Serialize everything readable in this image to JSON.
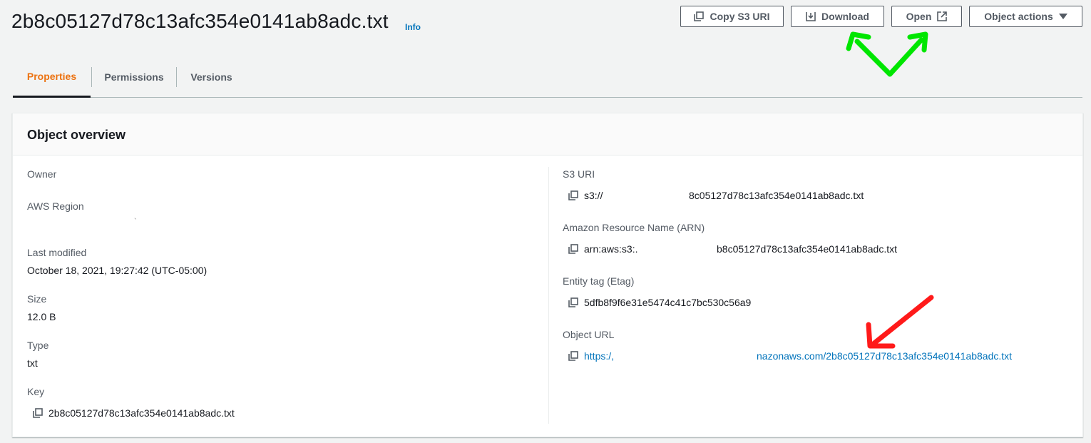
{
  "header": {
    "title": "2b8c05127d78c13afc354e0141ab8adc.txt",
    "info": "Info"
  },
  "toolbar": {
    "copy_label": "Copy S3 URI",
    "download_label": "Download",
    "open_label": "Open",
    "actions_label": "Object actions"
  },
  "tabs": [
    {
      "label": "Properties",
      "active": true
    },
    {
      "label": "Permissions",
      "active": false
    },
    {
      "label": "Versions",
      "active": false
    }
  ],
  "overview": {
    "title": "Object overview",
    "left": {
      "owner_label": "Owner",
      "region_label": "AWS Region",
      "region_value": "`",
      "modified_label": "Last modified",
      "modified_value": "October 18, 2021, 19:27:42 (UTC-05:00)",
      "size_label": "Size",
      "size_value": "12.0 B",
      "type_label": "Type",
      "type_value": "txt",
      "key_label": "Key",
      "key_value": "2b8c05127d78c13afc354e0141ab8adc.txt"
    },
    "right": {
      "s3uri_label": "S3 URI",
      "s3uri_prefix": "s3://",
      "s3uri_suffix": "8c05127d78c13afc354e0141ab8adc.txt",
      "arn_label": "Amazon Resource Name (ARN)",
      "arn_prefix": "arn:aws:s3:.",
      "arn_suffix": "b8c05127d78c13afc354e0141ab8adc.txt",
      "etag_label": "Entity tag (Etag)",
      "etag_value": "5dfb8f9f6e31e5474c41c7bc530c56a9",
      "url_label": "Object URL",
      "url_prefix": "https:/,",
      "url_suffix": "nazonaws.com/2b8c05127d78c13afc354e0141ab8adc.txt"
    }
  },
  "colors": {
    "accent_orange": "#ec7211",
    "link_blue": "#0073bb",
    "annotation_green": "#00e600",
    "annotation_red": "#ff1a1a"
  }
}
